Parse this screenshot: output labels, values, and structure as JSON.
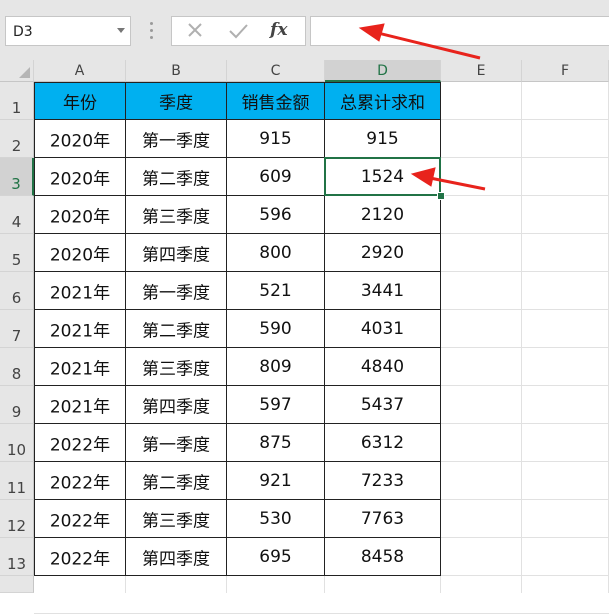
{
  "formula_bar": {
    "name_box": "D3",
    "cancel_icon": "✕",
    "enter_icon": "✓",
    "function_label": "fx",
    "formula": ""
  },
  "columns": [
    "A",
    "B",
    "C",
    "D",
    "E",
    "F"
  ],
  "selected_column": "D",
  "rows": [
    "1",
    "2",
    "3",
    "4",
    "5",
    "6",
    "7",
    "8",
    "9",
    "10",
    "11",
    "12",
    "13"
  ],
  "selected_row": "3",
  "table": {
    "headers": [
      "年份",
      "季度",
      "销售金额",
      "总累计求和"
    ],
    "body": [
      [
        "2020年",
        "第一季度",
        "915",
        "915"
      ],
      [
        "2020年",
        "第二季度",
        "609",
        "1524"
      ],
      [
        "2020年",
        "第三季度",
        "596",
        "2120"
      ],
      [
        "2020年",
        "第四季度",
        "800",
        "2920"
      ],
      [
        "2021年",
        "第一季度",
        "521",
        "3441"
      ],
      [
        "2021年",
        "第二季度",
        "590",
        "4031"
      ],
      [
        "2021年",
        "第三季度",
        "809",
        "4840"
      ],
      [
        "2021年",
        "第四季度",
        "597",
        "5437"
      ],
      [
        "2022年",
        "第一季度",
        "875",
        "6312"
      ],
      [
        "2022年",
        "第二季度",
        "921",
        "7233"
      ],
      [
        "2022年",
        "第三季度",
        "530",
        "7763"
      ],
      [
        "2022年",
        "第四季度",
        "695",
        "8458"
      ]
    ]
  },
  "annotation_color": "#e8231c",
  "header_fill_color": "#00b0f0",
  "selection_color": "#217346"
}
